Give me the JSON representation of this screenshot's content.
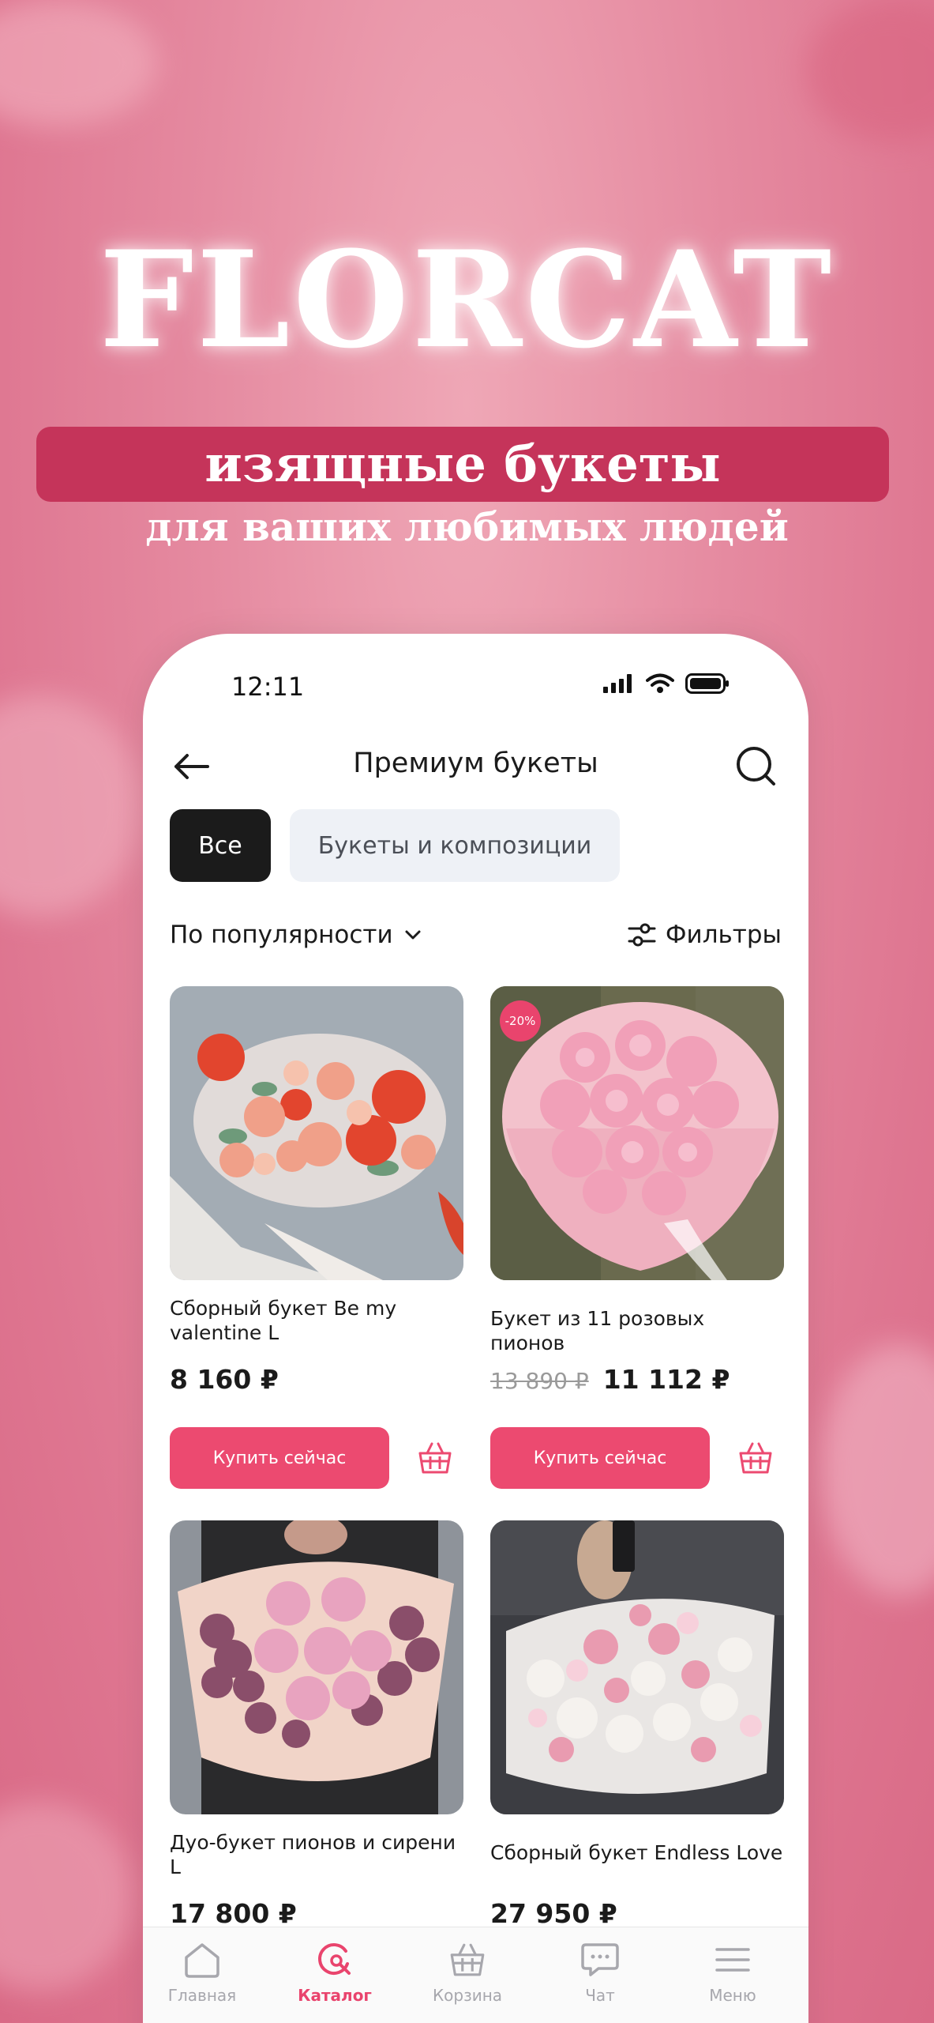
{
  "promo": {
    "brand": "FLORCAT",
    "headline": "изящные букеты",
    "tagline": "для ваших любимых людей"
  },
  "status_bar": {
    "time": "12:11"
  },
  "header": {
    "title": "Премиум букеты"
  },
  "chips": {
    "all": "Все",
    "category": "Букеты и композиции"
  },
  "sort": {
    "label": "По популярности",
    "filters_label": "Фильтры"
  },
  "products": [
    {
      "name": "Сборный букет Be my valentine L",
      "price": "8 160 ₽",
      "buy_label": "Купить сейчас"
    },
    {
      "name": "Букет из 11 розовых пионов",
      "badge": "-20%",
      "old_price": "13 890 ₽",
      "price": "11 112 ₽",
      "buy_label": "Купить сейчас"
    },
    {
      "name": "Дуо-букет пионов и сирени L",
      "price": "17 800 ₽"
    },
    {
      "name": "Сборный букет Endless Love",
      "price": "27 950 ₽"
    }
  ],
  "tabs": [
    {
      "label": "Главная",
      "icon": "home-icon"
    },
    {
      "label": "Каталог",
      "icon": "catalog-search-icon",
      "active": true
    },
    {
      "label": "Корзина",
      "icon": "basket-icon"
    },
    {
      "label": "Чат",
      "icon": "chat-icon"
    },
    {
      "label": "Меню",
      "icon": "menu-icon"
    }
  ],
  "colors": {
    "accent": "#ec4a70",
    "ribbon": "#c5345a",
    "chip_dark": "#1b1b1b",
    "chip_light": "#eef1f6"
  }
}
